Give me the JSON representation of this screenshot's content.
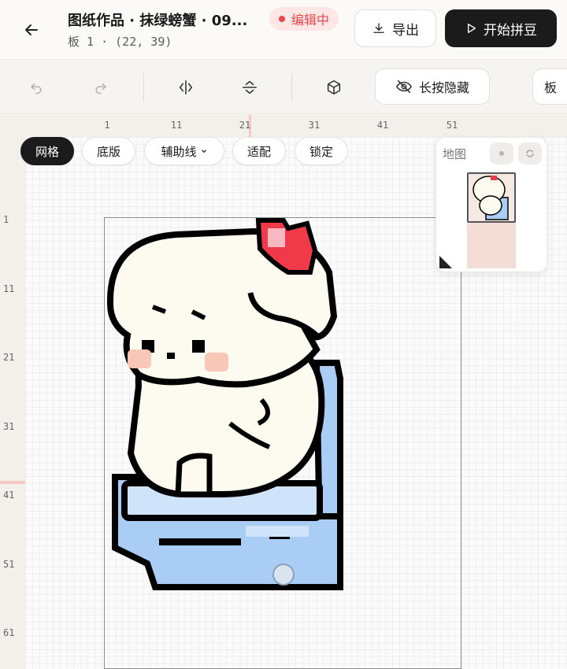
{
  "header": {
    "title": "图纸作品 · 抹绿螃蟹 · 09...",
    "subtitle": "板 1 · (22, 39)",
    "status_badge": "编辑中",
    "export_label": "导出",
    "start_label": "开始拼豆"
  },
  "toolbar": {
    "hide_label": "长按隐藏",
    "board_label": "板"
  },
  "chips": {
    "grid": "网格",
    "base": "底版",
    "guides": "辅助线",
    "fit": "适配",
    "lock": "锁定"
  },
  "minimap": {
    "label": "地图"
  },
  "rulers": {
    "top": [
      "1",
      "11",
      "21",
      "31",
      "41",
      "51"
    ],
    "left": [
      "1",
      "11",
      "21",
      "31",
      "41",
      "51",
      "61"
    ]
  },
  "colors": {
    "accent_dark": "#1b1b1b",
    "badge_red": "#e5484d",
    "outline": "#000000",
    "cream": "#fdfbef",
    "blue": "#a9cdf5",
    "blue_light": "#cfe3fb",
    "blush": "#f8c7b5",
    "red": "#f03a4a",
    "pink": "#f7b8c0"
  },
  "icons": {
    "back": "arrow-left-icon",
    "export": "download-icon",
    "start": "play-icon",
    "undo": "undo-icon",
    "redo": "redo-icon",
    "flip_h": "flip-horizontal-icon",
    "flip_v": "flip-vertical-icon",
    "cube": "cube-icon",
    "hide": "eye-off-icon",
    "guides_dropdown": "chevron-down-icon"
  }
}
